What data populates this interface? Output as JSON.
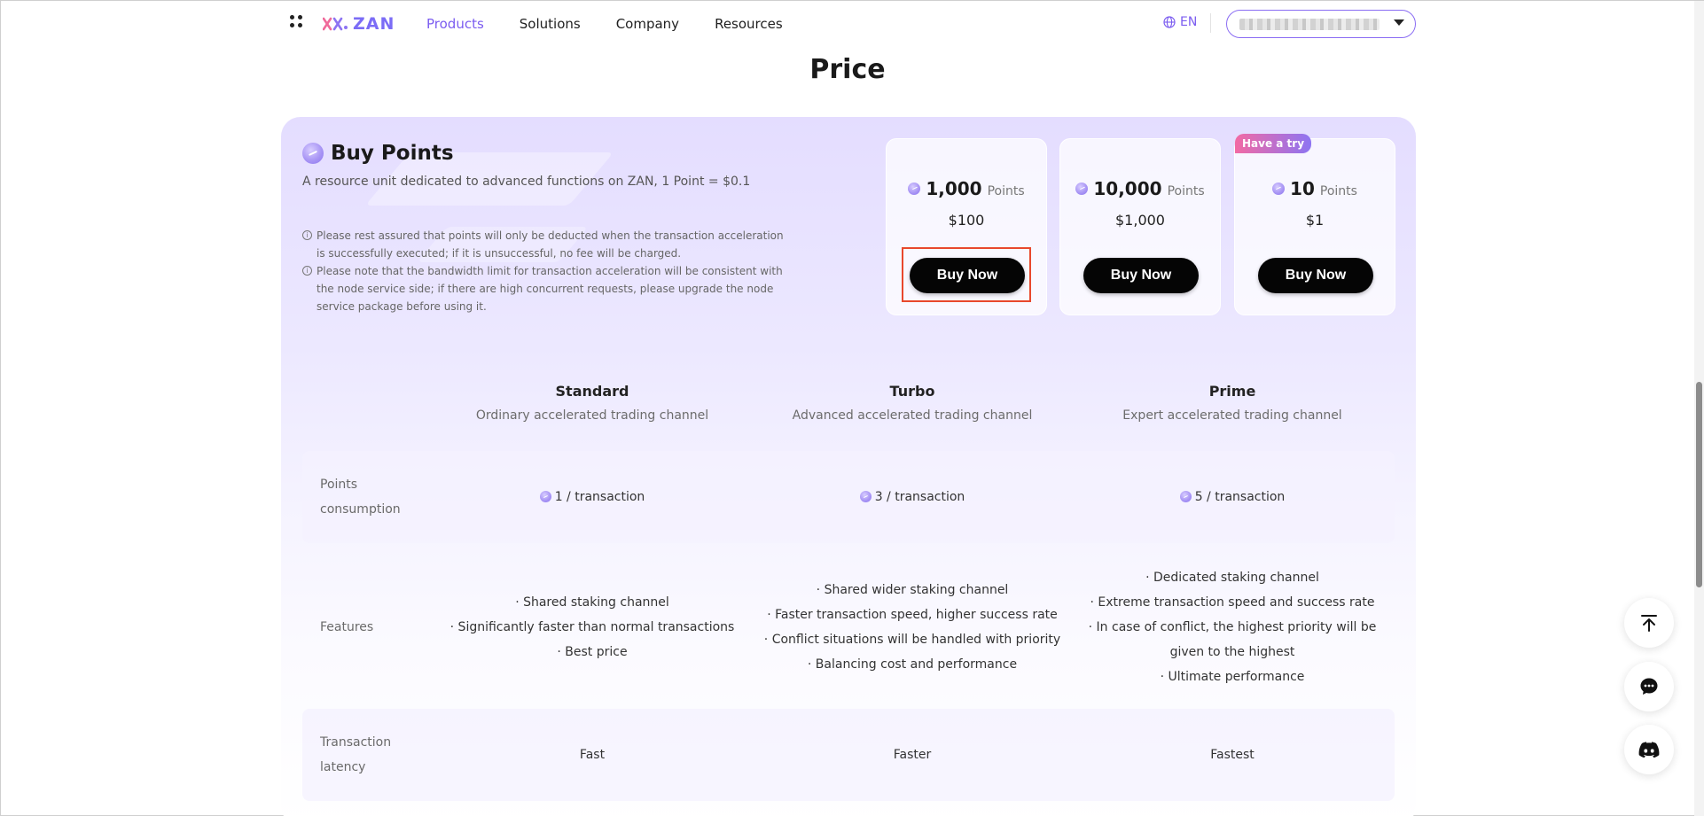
{
  "header": {
    "logo_text": "ZAN",
    "nav": [
      "Products",
      "Solutions",
      "Company",
      "Resources"
    ],
    "active_nav": "Products",
    "language": "EN"
  },
  "page_title": "Price",
  "buy_points": {
    "title": "Buy Points",
    "description": "A resource unit dedicated to advanced functions on ZAN, 1 Point = $0.1",
    "notes": [
      "Please rest assured that points will only be deducted when the transaction acceleration is successfully executed; if it is unsuccessful, no fee will be charged.",
      "Please note that the bandwidth limit for transaction acceleration will be consistent with the node service side; if there are high concurrent requests, please upgrade the node service package before using it."
    ],
    "packages": [
      {
        "amount": "1,000",
        "unit": "Points",
        "price": "$100",
        "button": "Buy Now"
      },
      {
        "amount": "10,000",
        "unit": "Points",
        "price": "$1,000",
        "button": "Buy Now"
      },
      {
        "amount": "10",
        "unit": "Points",
        "price": "$1",
        "button": "Buy Now",
        "badge": "Have a try"
      }
    ]
  },
  "tiers": [
    {
      "name": "Standard",
      "subtitle": "Ordinary accelerated trading channel"
    },
    {
      "name": "Turbo",
      "subtitle": "Advanced accelerated trading channel"
    },
    {
      "name": "Prime",
      "subtitle": "Expert accelerated trading channel"
    }
  ],
  "table": {
    "points_label_1": "Points",
    "points_label_2": "consumption",
    "points": [
      "1 / transaction",
      "3 / transaction",
      "5 / transaction"
    ],
    "features_label": "Features",
    "features": [
      [
        "· Shared staking channel",
        "· Significantly faster than normal transactions",
        "· Best price"
      ],
      [
        "· Shared wider staking channel",
        "· Faster transaction speed, higher success rate",
        "· Conflict situations will be handled with priority",
        "· Balancing cost and performance"
      ],
      [
        "· Dedicated staking channel",
        "· Extreme transaction speed and success rate",
        "· In case of conflict, the highest priority will be",
        "given to the highest",
        "· Ultimate performance"
      ]
    ],
    "latency_label_1": "Transaction",
    "latency_label_2": "latency",
    "latency": [
      "Fast",
      "Faster",
      "Fastest"
    ]
  },
  "icons": {
    "grid": "apps-grid-icon",
    "globe": "globe-icon",
    "point": "point-coin-icon",
    "back_to_top": "back-to-top-icon",
    "chat": "chat-icon",
    "discord": "discord-icon"
  },
  "colors": {
    "accent": "#7b5cf0",
    "button": "#050505",
    "highlight": "#e8482c"
  }
}
